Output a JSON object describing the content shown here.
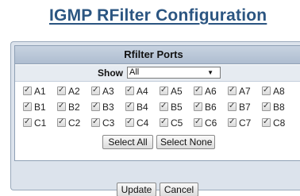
{
  "page": {
    "title": "IGMP RFilter Configuration"
  },
  "panel": {
    "header": "Rfilter Ports",
    "show_label": "Show",
    "show_value": "All"
  },
  "ports": {
    "rows": [
      [
        {
          "label": "A1",
          "checked": true
        },
        {
          "label": "A2",
          "checked": true
        },
        {
          "label": "A3",
          "checked": true
        },
        {
          "label": "A4",
          "checked": true
        },
        {
          "label": "A5",
          "checked": true
        },
        {
          "label": "A6",
          "checked": true
        },
        {
          "label": "A7",
          "checked": true
        },
        {
          "label": "A8",
          "checked": true
        }
      ],
      [
        {
          "label": "B1",
          "checked": true
        },
        {
          "label": "B2",
          "checked": true
        },
        {
          "label": "B3",
          "checked": true
        },
        {
          "label": "B4",
          "checked": true
        },
        {
          "label": "B5",
          "checked": true
        },
        {
          "label": "B6",
          "checked": true
        },
        {
          "label": "B7",
          "checked": true
        },
        {
          "label": "B8",
          "checked": true
        }
      ],
      [
        {
          "label": "C1",
          "checked": true
        },
        {
          "label": "C2",
          "checked": true
        },
        {
          "label": "C3",
          "checked": true
        },
        {
          "label": "C4",
          "checked": true
        },
        {
          "label": "C5",
          "checked": true
        },
        {
          "label": "C6",
          "checked": true
        },
        {
          "label": "C7",
          "checked": true
        },
        {
          "label": "C8",
          "checked": true
        }
      ]
    ]
  },
  "buttons": {
    "select_all": "Select All",
    "select_none": "Select None",
    "update": "Update",
    "cancel": "Cancel"
  }
}
